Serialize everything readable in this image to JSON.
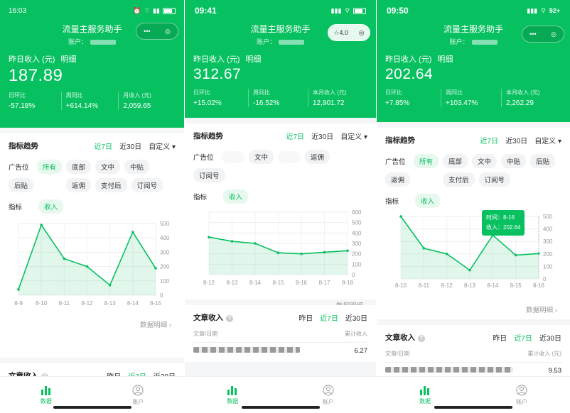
{
  "screen1": {
    "status_time": "16:03",
    "title": "流量主服务助手",
    "account_label": "账户：",
    "income_label": "昨日收入 (元)",
    "detail_link": "明细",
    "income_value": "187.89",
    "stats": [
      {
        "label": "日环比",
        "value": "-57.18%"
      },
      {
        "label": "周同比",
        "value": "+614.14%"
      },
      {
        "label": "月收入 (元)",
        "value": "2,059.65"
      }
    ],
    "trend_title": "指标趋势",
    "trend_tabs": [
      "近7日",
      "近30日",
      "自定义"
    ],
    "ad_label": "广告位",
    "ad_chips": [
      "所有",
      "底部",
      "文中",
      "中贴",
      "后贴",
      "返佣",
      "支付后",
      "订阅号"
    ],
    "metric_label": "指标",
    "metric_chip": "收入",
    "y_ticks": [
      "500",
      "400",
      "300",
      "200",
      "100",
      "0"
    ],
    "x_ticks": [
      "8-9",
      "8-10",
      "8-11",
      "8-12",
      "8-13",
      "8-14",
      "8-15"
    ],
    "data_detail": "数据明细",
    "article_title": "文章收入",
    "article_tabs": [
      "昨日",
      "近7日",
      "近30日"
    ],
    "tab_data": "数据",
    "tab_account": "账户"
  },
  "screen2": {
    "status_time": "09:41",
    "title": "流量主服务助手",
    "capsule_text": "☆4.0",
    "account_label": "账户：",
    "income_label": "昨日收入 (元)",
    "detail_link": "明细",
    "income_value": "312.67",
    "stats": [
      {
        "label": "日环比",
        "value": "+15.02%"
      },
      {
        "label": "周同比",
        "value": "-16.52%"
      },
      {
        "label": "本月收入 (元)",
        "value": "12,901.72"
      }
    ],
    "trend_title": "指标趋势",
    "trend_tabs": [
      "近7日",
      "近30日",
      "自定义"
    ],
    "ad_label": "广告位",
    "ad_chips": [
      "文中",
      "返佣",
      "订阅号"
    ],
    "metric_label": "指标",
    "metric_chip": "收入",
    "y_ticks": [
      "600",
      "500",
      "400",
      "300",
      "200",
      "100",
      "0"
    ],
    "x_ticks": [
      "8-12",
      "8-13",
      "8-14",
      "8-15",
      "8-16",
      "8-17",
      "8-18"
    ],
    "data_detail": "数据明细",
    "article_title": "文章收入",
    "article_tabs": [
      "昨日",
      "近7日",
      "近30日"
    ],
    "table_headers": [
      "文章/日期",
      "累计收入"
    ],
    "table_value": "6.27",
    "tab_data": "数据",
    "tab_account": "账户"
  },
  "screen3": {
    "status_time": "09:50",
    "battery": "92+",
    "title": "流量主服务助手",
    "account_label": "账户：",
    "income_label": "昨日收入 (元)",
    "detail_link": "明细",
    "income_value": "202.64",
    "stats": [
      {
        "label": "日环比",
        "value": "+7.85%"
      },
      {
        "label": "周同比",
        "value": "+103.47%"
      },
      {
        "label": "本月收入 (元)",
        "value": "2,262.29"
      }
    ],
    "trend_title": "指标趋势",
    "trend_tabs": [
      "近7日",
      "近30日",
      "自定义"
    ],
    "ad_label": "广告位",
    "ad_chips": [
      "所有",
      "底部",
      "文中",
      "中贴",
      "后贴",
      "返佣",
      "支付后",
      "订阅号"
    ],
    "metric_label": "指标",
    "metric_chip": "收入",
    "y_ticks": [
      "500",
      "400",
      "300",
      "200",
      "100",
      "0"
    ],
    "x_ticks": [
      "8-10",
      "8-11",
      "8-12",
      "8-13",
      "8-14",
      "8-15",
      "8-16"
    ],
    "tooltip_time": "时间：8-16",
    "tooltip_income": "收入：202.64",
    "data_detail": "数据明细",
    "article_title": "文章收入",
    "article_tabs": [
      "昨日",
      "近7日",
      "近30日"
    ],
    "table_headers": [
      "文章/日期",
      "累计收入 (元)"
    ],
    "table_value": "9.53",
    "tab_data": "数据",
    "tab_account": "账户"
  },
  "chart_data": [
    {
      "type": "area",
      "x": [
        "8-9",
        "8-10",
        "8-11",
        "8-12",
        "8-13",
        "8-14",
        "8-15"
      ],
      "values": [
        40,
        490,
        255,
        200,
        70,
        440,
        188
      ],
      "ylim": [
        0,
        500
      ],
      "y_ticks": [
        0,
        100,
        200,
        300,
        400,
        500
      ]
    },
    {
      "type": "area",
      "x": [
        "8-12",
        "8-13",
        "8-14",
        "8-15",
        "8-16",
        "8-17",
        "8-18"
      ],
      "values": [
        360,
        320,
        300,
        210,
        200,
        215,
        230
      ],
      "ylim": [
        0,
        600
      ],
      "y_ticks": [
        0,
        100,
        200,
        300,
        400,
        500,
        600
      ]
    },
    {
      "type": "area",
      "x": [
        "8-10",
        "8-11",
        "8-12",
        "8-13",
        "8-14",
        "8-15",
        "8-16"
      ],
      "values": [
        500,
        245,
        200,
        70,
        350,
        190,
        202.64
      ],
      "ylim": [
        0,
        500
      ],
      "y_ticks": [
        0,
        100,
        200,
        300,
        400,
        500
      ]
    }
  ],
  "colors": {
    "brand": "#07c160",
    "chip_active_bg": "#e7f8ee"
  }
}
